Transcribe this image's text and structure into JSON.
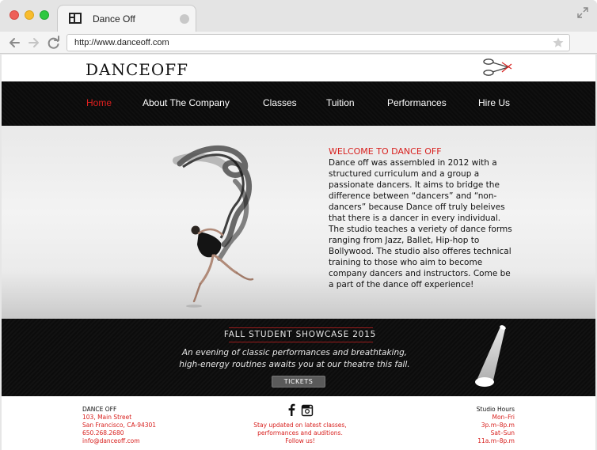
{
  "browser": {
    "tab_title": "Dance Off",
    "url": "http://www.danceoff.com"
  },
  "site": {
    "logo": "DANCEOFF",
    "nav": [
      {
        "label": "Home",
        "active": true
      },
      {
        "label": "About The Company"
      },
      {
        "label": "Classes"
      },
      {
        "label": "Tuition"
      },
      {
        "label": "Performances"
      },
      {
        "label": "Hire Us"
      }
    ]
  },
  "hero": {
    "heading": "WELCOME TO DANCE OFF",
    "paragraph1": "Dance off was assembled in 2012 with a structured curriculum and a group a passionate dancers. It aims to bridge the difference between “dancers” and “non-dancers” because Dance off truly beleives that there is a dancer in every individual.",
    "paragraph2": "The studio teaches a veriety of dance forms ranging from Jazz, Ballet, Hip-hop to Bollywood. The studio also offeres technical training to those who aim to become company dancers and instructors. Come be a part of the dance off experience!"
  },
  "showcase": {
    "title": "FALL STUDENT SHOWCASE 2015",
    "line1": "An evening of classic performances and breathtaking,",
    "line2": "high-energy routines awaits you at our theatre this fall.",
    "button": "TICKETS"
  },
  "footer": {
    "name": "DANCE OFF",
    "address1": "103, Main Street",
    "address2": "San Francisco, CA-94301",
    "phone": "650.268.2680",
    "email": "info@danceoff.com",
    "social_line1": "Stay updated on latest classes,",
    "social_line2": "performances and auditions.",
    "social_line3": "Follow us!",
    "hours_title": "Studio Hours",
    "hours_days1": "Mon–Fri",
    "hours_time1": "3p.m–8p.m",
    "hours_days2": "Sat–Sun",
    "hours_time2": "11a.m–8p.m"
  },
  "colors": {
    "accent": "#d8201e",
    "nav_bg": "#0b0b0b"
  }
}
